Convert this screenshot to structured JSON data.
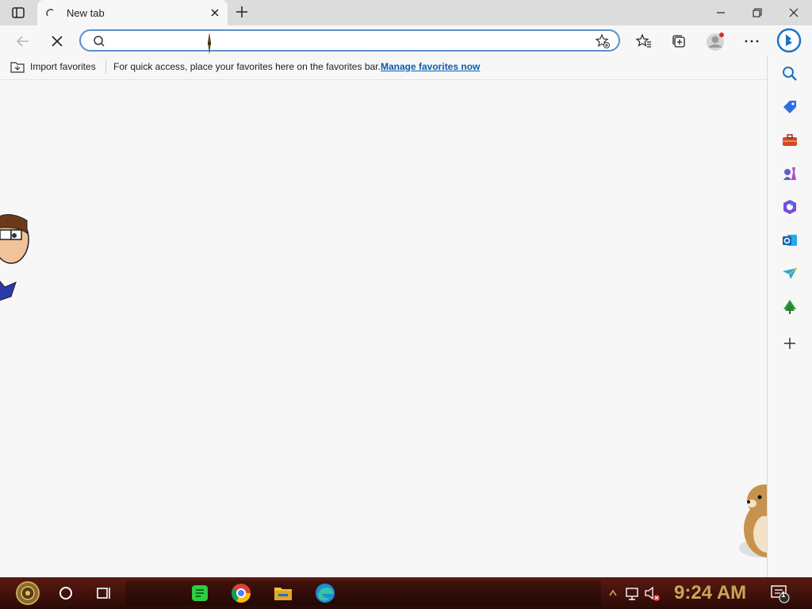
{
  "window": {
    "tab_title": "New tab",
    "controls": {
      "minimize": "minimize-icon",
      "restore": "restore-icon",
      "close": "close-icon"
    }
  },
  "address_bar": {
    "value": "",
    "placeholder": ""
  },
  "favorites_bar": {
    "import_label": "Import favorites",
    "message": "For quick access, place your favorites here on the favorites bar.",
    "manage_link": "Manage favorites now"
  },
  "sidebar": {
    "items": [
      "search-icon",
      "shopping-tag-icon",
      "tools-icon",
      "games-icon",
      "office-icon",
      "outlook-icon",
      "send-icon",
      "tree-icon",
      "add-icon"
    ]
  },
  "taskbar": {
    "time": "9:24 AM",
    "notification_count": "1",
    "colors": {
      "clock": "#c9a55a",
      "bar": "#3a0f0a"
    }
  },
  "colors": {
    "accent": "#0b5cad",
    "address_border": "#5a8fd0"
  }
}
